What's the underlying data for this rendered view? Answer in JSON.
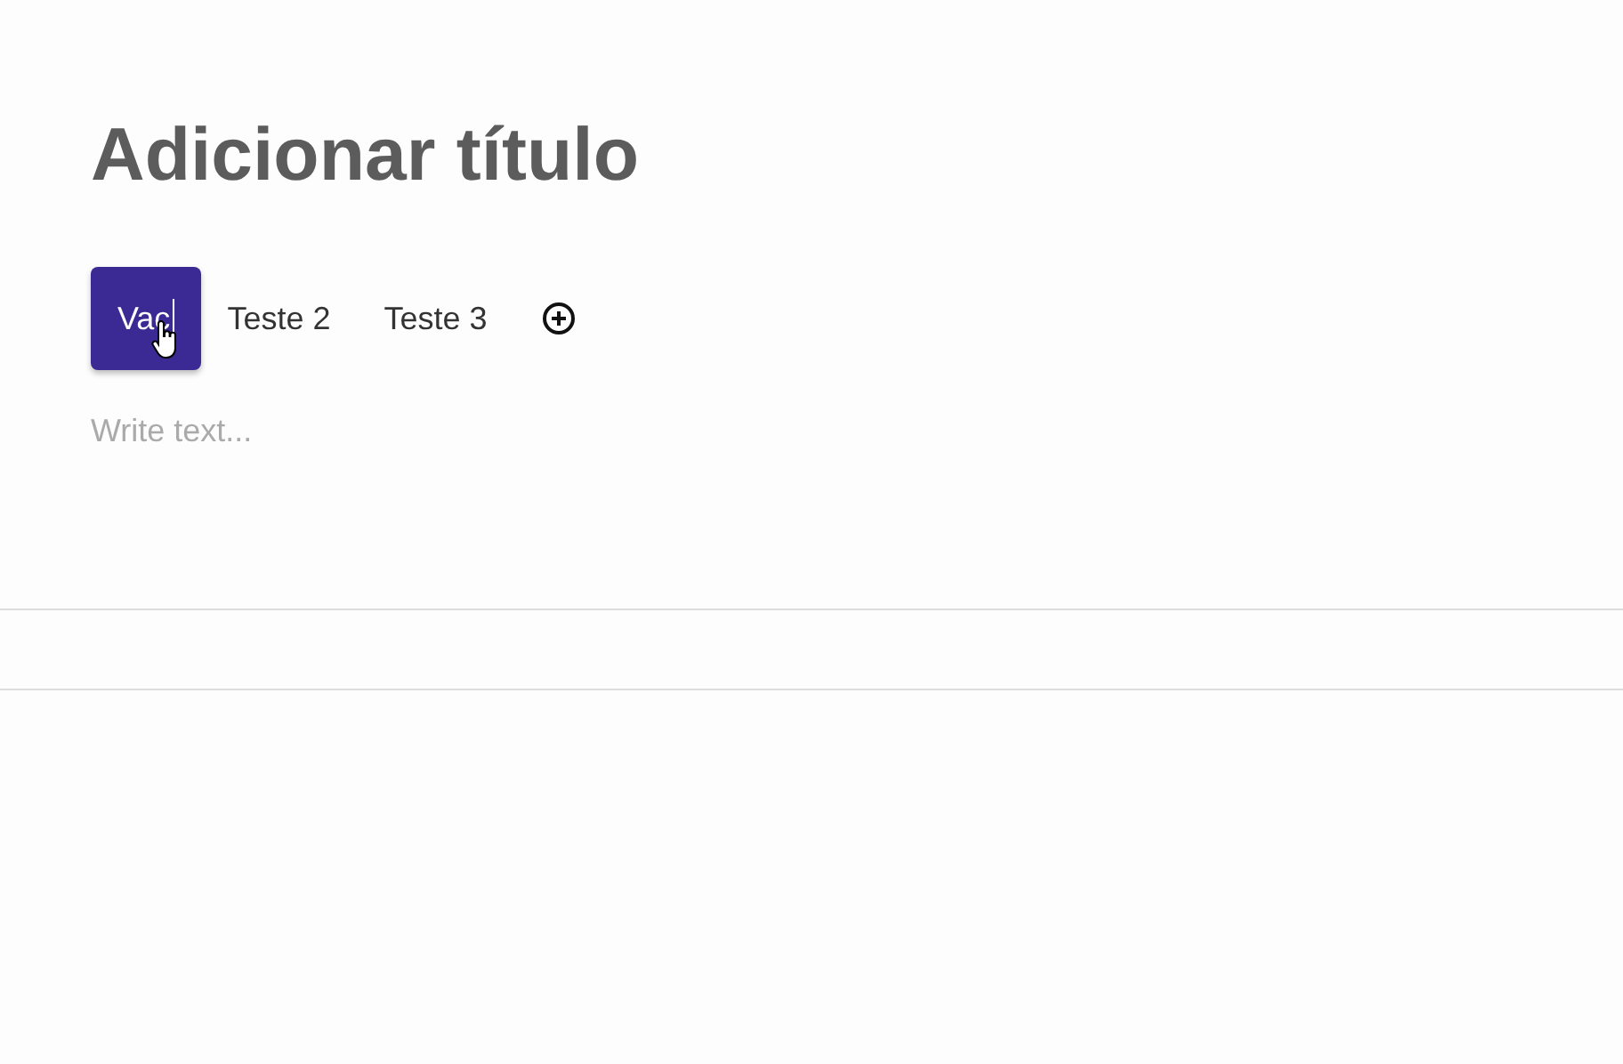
{
  "title": "Adicionar título",
  "tabs": [
    {
      "label": "Vac",
      "selected": true,
      "editing": true
    },
    {
      "label": "Teste 2",
      "selected": false,
      "editing": false
    },
    {
      "label": "Teste 3",
      "selected": false,
      "editing": false
    }
  ],
  "editor": {
    "placeholder": "Write text..."
  }
}
